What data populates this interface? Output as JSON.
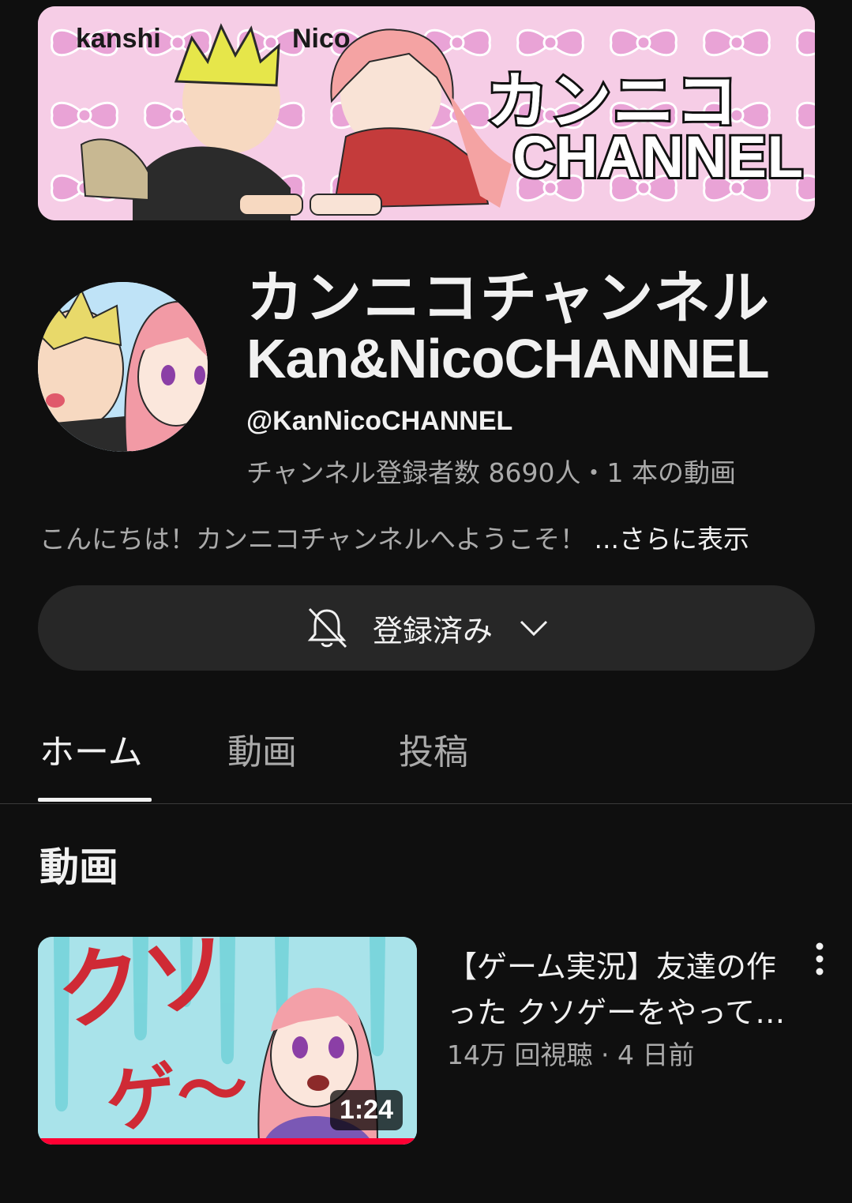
{
  "banner": {
    "left_name": "kanshi",
    "right_name": "Nico",
    "title_jp": "カンニコ",
    "title_en": "CHANNEL"
  },
  "channel": {
    "name_jp": "カンニコチャンネル",
    "name_en": "Kan&NicoCHANNEL",
    "handle": "@KanNicoCHANNEL",
    "stats": "チャンネル登録者数 8690人・1 本の動画",
    "description": "こんにちは！カンニコチャンネルへようこそ！",
    "description_more": "...さらに表示"
  },
  "subscribe": {
    "label": "登録済み",
    "bell_icon": "bell-off-icon",
    "chevron_icon": "chevron-down-icon"
  },
  "tabs": [
    {
      "label": "ホーム",
      "active": true
    },
    {
      "label": "動画",
      "active": false
    },
    {
      "label": "投稿",
      "active": false
    }
  ],
  "section": {
    "title": "動画"
  },
  "videos": [
    {
      "title": "【ゲーム実況】友達の作った クソゲーをやってみた",
      "meta": "14万 回視聴 · 4 日前",
      "duration": "1:24",
      "thumbnail_text": "クソゲ〜",
      "watch_progress": 1.0
    }
  ],
  "colors": {
    "background": "#0f0f0f",
    "surface": "#272727",
    "text_primary": "#f1f1f1",
    "text_secondary": "#aaaaaa",
    "progress": "#ff0033",
    "banner_pink": "#f3c8e3"
  }
}
